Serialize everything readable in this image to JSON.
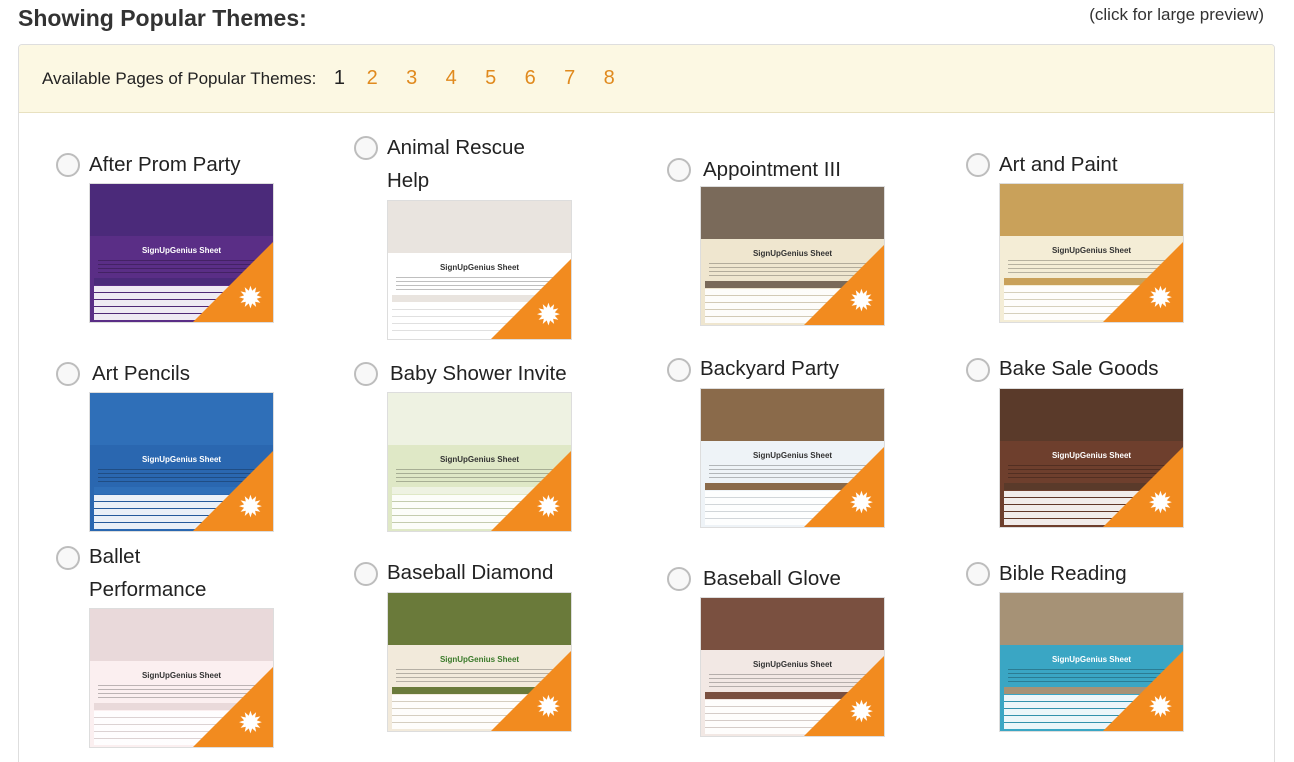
{
  "header": {
    "title": "Showing Popular Themes:",
    "hint": "(click for large preview)"
  },
  "pager": {
    "label": "Available Pages of Popular Themes:",
    "current": "1",
    "pages": [
      "2",
      "3",
      "4",
      "5",
      "6",
      "7",
      "8"
    ]
  },
  "themes": [
    {
      "name": "After Prom Party",
      "header_color": "#4b2a7a",
      "body_color": "#5a2e86",
      "sheet_title": "SignUpGenius Sheet",
      "title_color": "#ffffff"
    },
    {
      "name": "Animal Rescue Help",
      "header_color": "#e9e4df",
      "body_color": "#ffffff",
      "sheet_title": "SignUpGenius Sheet",
      "title_color": "#333333"
    },
    {
      "name": "Appointment III",
      "header_color": "#7a6a5a",
      "body_color": "#efe6cf",
      "sheet_title": "SignUpGenius Sheet",
      "title_color": "#333333"
    },
    {
      "name": "Art and Paint",
      "header_color": "#c9a15a",
      "body_color": "#f4edd6",
      "sheet_title": "SignUpGenius Sheet",
      "title_color": "#333333"
    },
    {
      "name": "Art Pencils",
      "header_color": "#2f6fb8",
      "body_color": "#2a67b0",
      "sheet_title": "SignUpGenius Sheet",
      "title_color": "#ffffff"
    },
    {
      "name": "Baby Shower Invite",
      "header_color": "#eef2e2",
      "body_color": "#dfe8c6",
      "sheet_title": "SignUpGenius Sheet",
      "title_color": "#333333"
    },
    {
      "name": "Backyard Party",
      "header_color": "#8a6a4a",
      "body_color": "#eef3f7",
      "sheet_title": "SignUpGenius Sheet",
      "title_color": "#333333"
    },
    {
      "name": "Bake Sale Goods",
      "header_color": "#5a3a2a",
      "body_color": "#6e3f2d",
      "sheet_title": "SignUpGenius Sheet",
      "title_color": "#ffffff"
    },
    {
      "name": "Ballet Performance",
      "header_color": "#e9d9da",
      "body_color": "#fbeff0",
      "sheet_title": "SignUpGenius Sheet",
      "title_color": "#333333"
    },
    {
      "name": "Baseball Diamond",
      "header_color": "#6a7a3a",
      "body_color": "#f2eadb",
      "sheet_title": "SignUpGenius Sheet",
      "title_color": "#3a7a2a"
    },
    {
      "name": "Baseball Glove",
      "header_color": "#7a5040",
      "body_color": "#f2e8e4",
      "sheet_title": "SignUpGenius Sheet",
      "title_color": "#333333"
    },
    {
      "name": "Bible Reading",
      "header_color": "#a69276",
      "body_color": "#3aa6c4",
      "sheet_title": "SignUpGenius Sheet",
      "title_color": "#ffffff"
    }
  ],
  "colors": {
    "accent": "#e08a1e",
    "pager_bg": "#fcf8e3",
    "badge": "#f28b1f"
  }
}
